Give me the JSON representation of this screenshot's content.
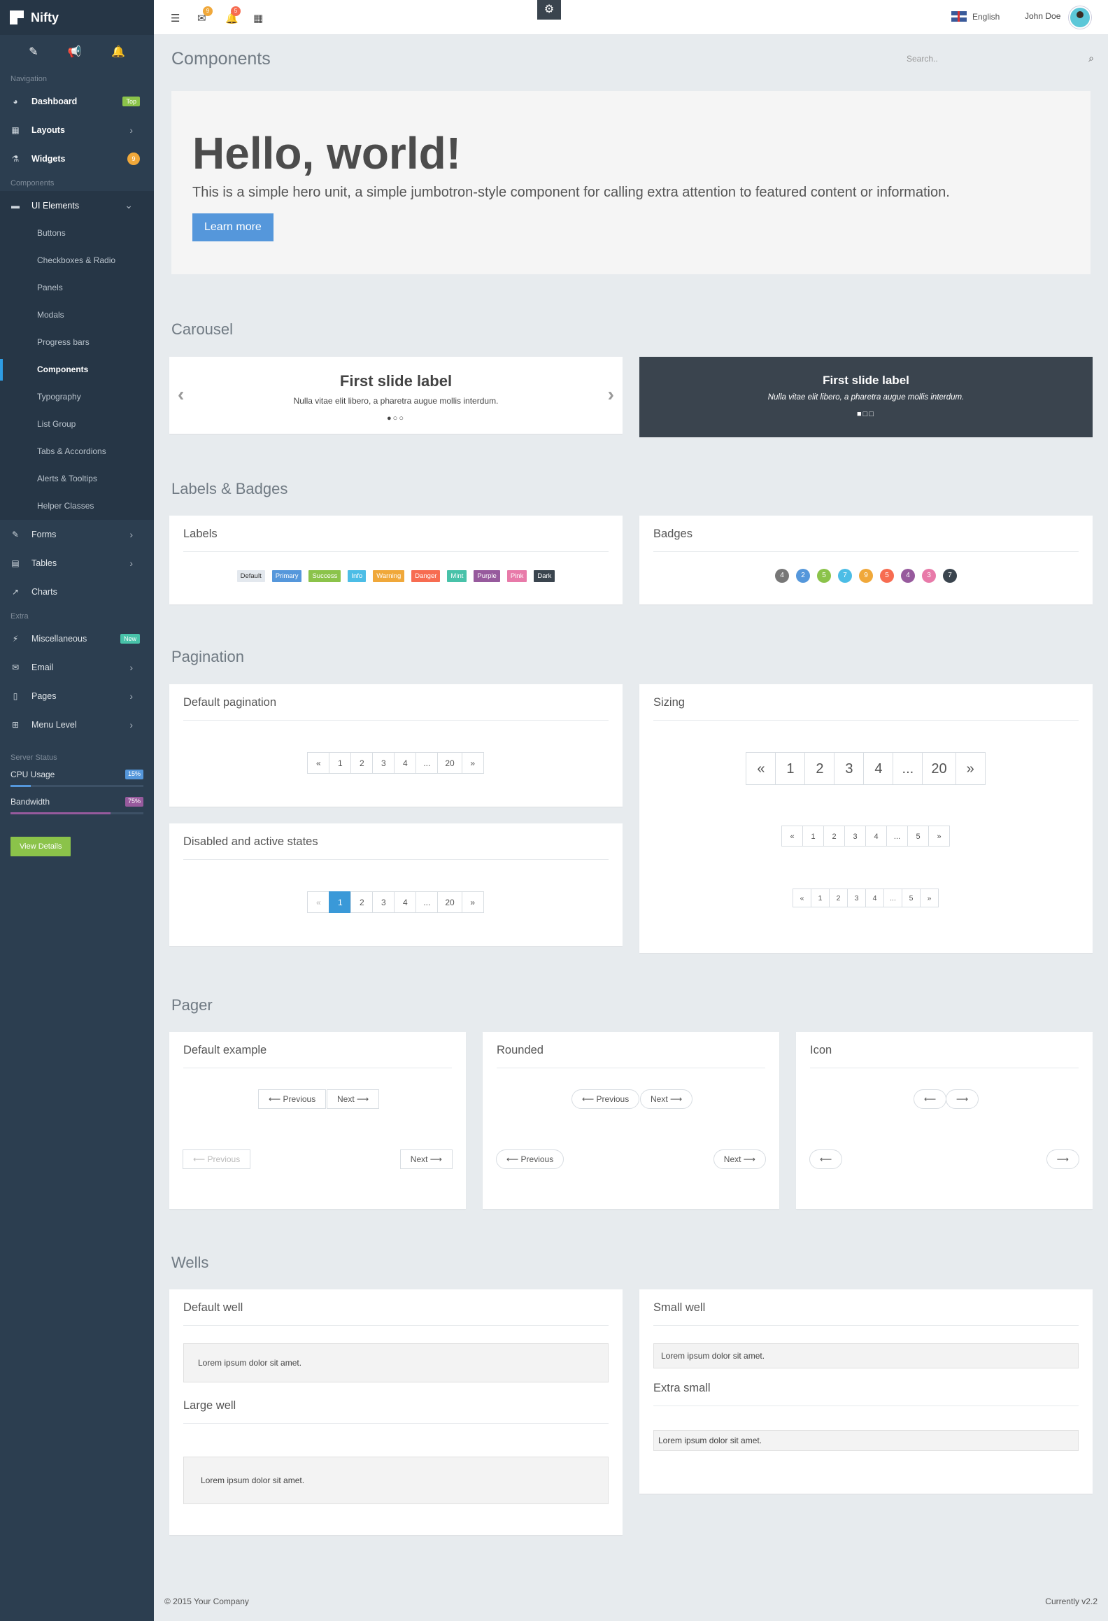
{
  "brand": {
    "name": "Nifty"
  },
  "quick": [
    "magic-wand",
    "bullhorn",
    "bell"
  ],
  "sidebar": {
    "nav_heading": "Navigation",
    "nav": [
      {
        "label": "Dashboard",
        "tag": "Top",
        "tag_color": "#8bc34a"
      },
      {
        "label": "Layouts"
      },
      {
        "label": "Widgets",
        "tag": "9",
        "tag_color": "#f0a83a"
      }
    ],
    "comp_heading": "Components",
    "ui": "UI Elements",
    "sub": [
      "Buttons",
      "Checkboxes & Radio",
      "Panels",
      "Modals",
      "Progress bars",
      "Components",
      "Typography",
      "List Group",
      "Tabs & Accordions",
      "Alerts & Tooltips",
      "Helper Classes"
    ],
    "more": [
      "Forms",
      "Tables",
      "Charts"
    ],
    "extra_heading": "Extra",
    "extra": [
      {
        "label": "Miscellaneous",
        "tag": "New"
      },
      {
        "label": "Email"
      },
      {
        "label": "Pages"
      },
      {
        "label": "Menu Level"
      }
    ],
    "server_heading": "Server Status",
    "cpu": {
      "label": "CPU Usage",
      "value": "15%",
      "level": 0.15
    },
    "bw": {
      "label": "Bandwidth",
      "value": "75%",
      "level": 0.75
    },
    "view": "View Details"
  },
  "top": {
    "mail_count": "9",
    "bell_count": "5",
    "lang": "English",
    "user": "John Doe"
  },
  "page": {
    "title": "Components",
    "search_placeholder": "Search.."
  },
  "hero": {
    "title": "Hello, world!",
    "text": "This is a simple hero unit, a simple jumbotron-style component for calling extra attention to featured content or information.",
    "button": "Learn more"
  },
  "sections": {
    "carousel": "Carousel",
    "labels": "Labels & Badges",
    "pagination": "Pagination",
    "pager": "Pager",
    "wells": "Wells"
  },
  "carousel": {
    "title": "First slide label",
    "text": "Nulla vitae elit libero, a pharetra augue mollis interdum."
  },
  "labels": {
    "title": "Labels",
    "items": [
      {
        "t": "Default",
        "c": "#e3e8ee",
        "f": "#333"
      },
      {
        "t": "Primary",
        "c": "#5597db"
      },
      {
        "t": "Success",
        "c": "#8bc34a"
      },
      {
        "t": "Info",
        "c": "#4cbde6"
      },
      {
        "t": "Warning",
        "c": "#f0a83a"
      },
      {
        "t": "Danger",
        "c": "#f76c51"
      },
      {
        "t": "Mint",
        "c": "#48c2a9"
      },
      {
        "t": "Purple",
        "c": "#975a9d"
      },
      {
        "t": "Pink",
        "c": "#e87aa9"
      },
      {
        "t": "Dark",
        "c": "#3a444e"
      }
    ]
  },
  "badges": {
    "title": "Badges",
    "items": [
      {
        "t": "4",
        "c": "#777"
      },
      {
        "t": "2",
        "c": "#5597db"
      },
      {
        "t": "5",
        "c": "#8bc34a"
      },
      {
        "t": "7",
        "c": "#4cbde6"
      },
      {
        "t": "9",
        "c": "#f0a83a"
      },
      {
        "t": "5",
        "c": "#f76c51"
      },
      {
        "t": "4",
        "c": "#975a9d"
      },
      {
        "t": "3",
        "c": "#e87aa9"
      },
      {
        "t": "7",
        "c": "#3a444e"
      }
    ]
  },
  "pagination": {
    "default": "Default pagination",
    "states": "Disabled and active states",
    "sizing": "Sizing",
    "pages": [
      "«",
      "1",
      "2",
      "3",
      "4",
      "...",
      "20",
      "»"
    ],
    "small_pages": [
      "«",
      "1",
      "2",
      "3",
      "4",
      "...",
      "5",
      "»"
    ]
  },
  "pager": {
    "default": "Default example",
    "rounded": "Rounded",
    "icon": "Icon",
    "prev": "⟵ Previous",
    "next": "Next ⟶",
    "left": "⟵",
    "right": "⟶"
  },
  "wells": {
    "default": "Default well",
    "large": "Large well",
    "small": "Small well",
    "xs": "Extra small",
    "text": "Lorem ipsum dolor sit amet."
  },
  "footer": {
    "copy": "© 2015 Your Company",
    "version": "Currently v2.2"
  }
}
